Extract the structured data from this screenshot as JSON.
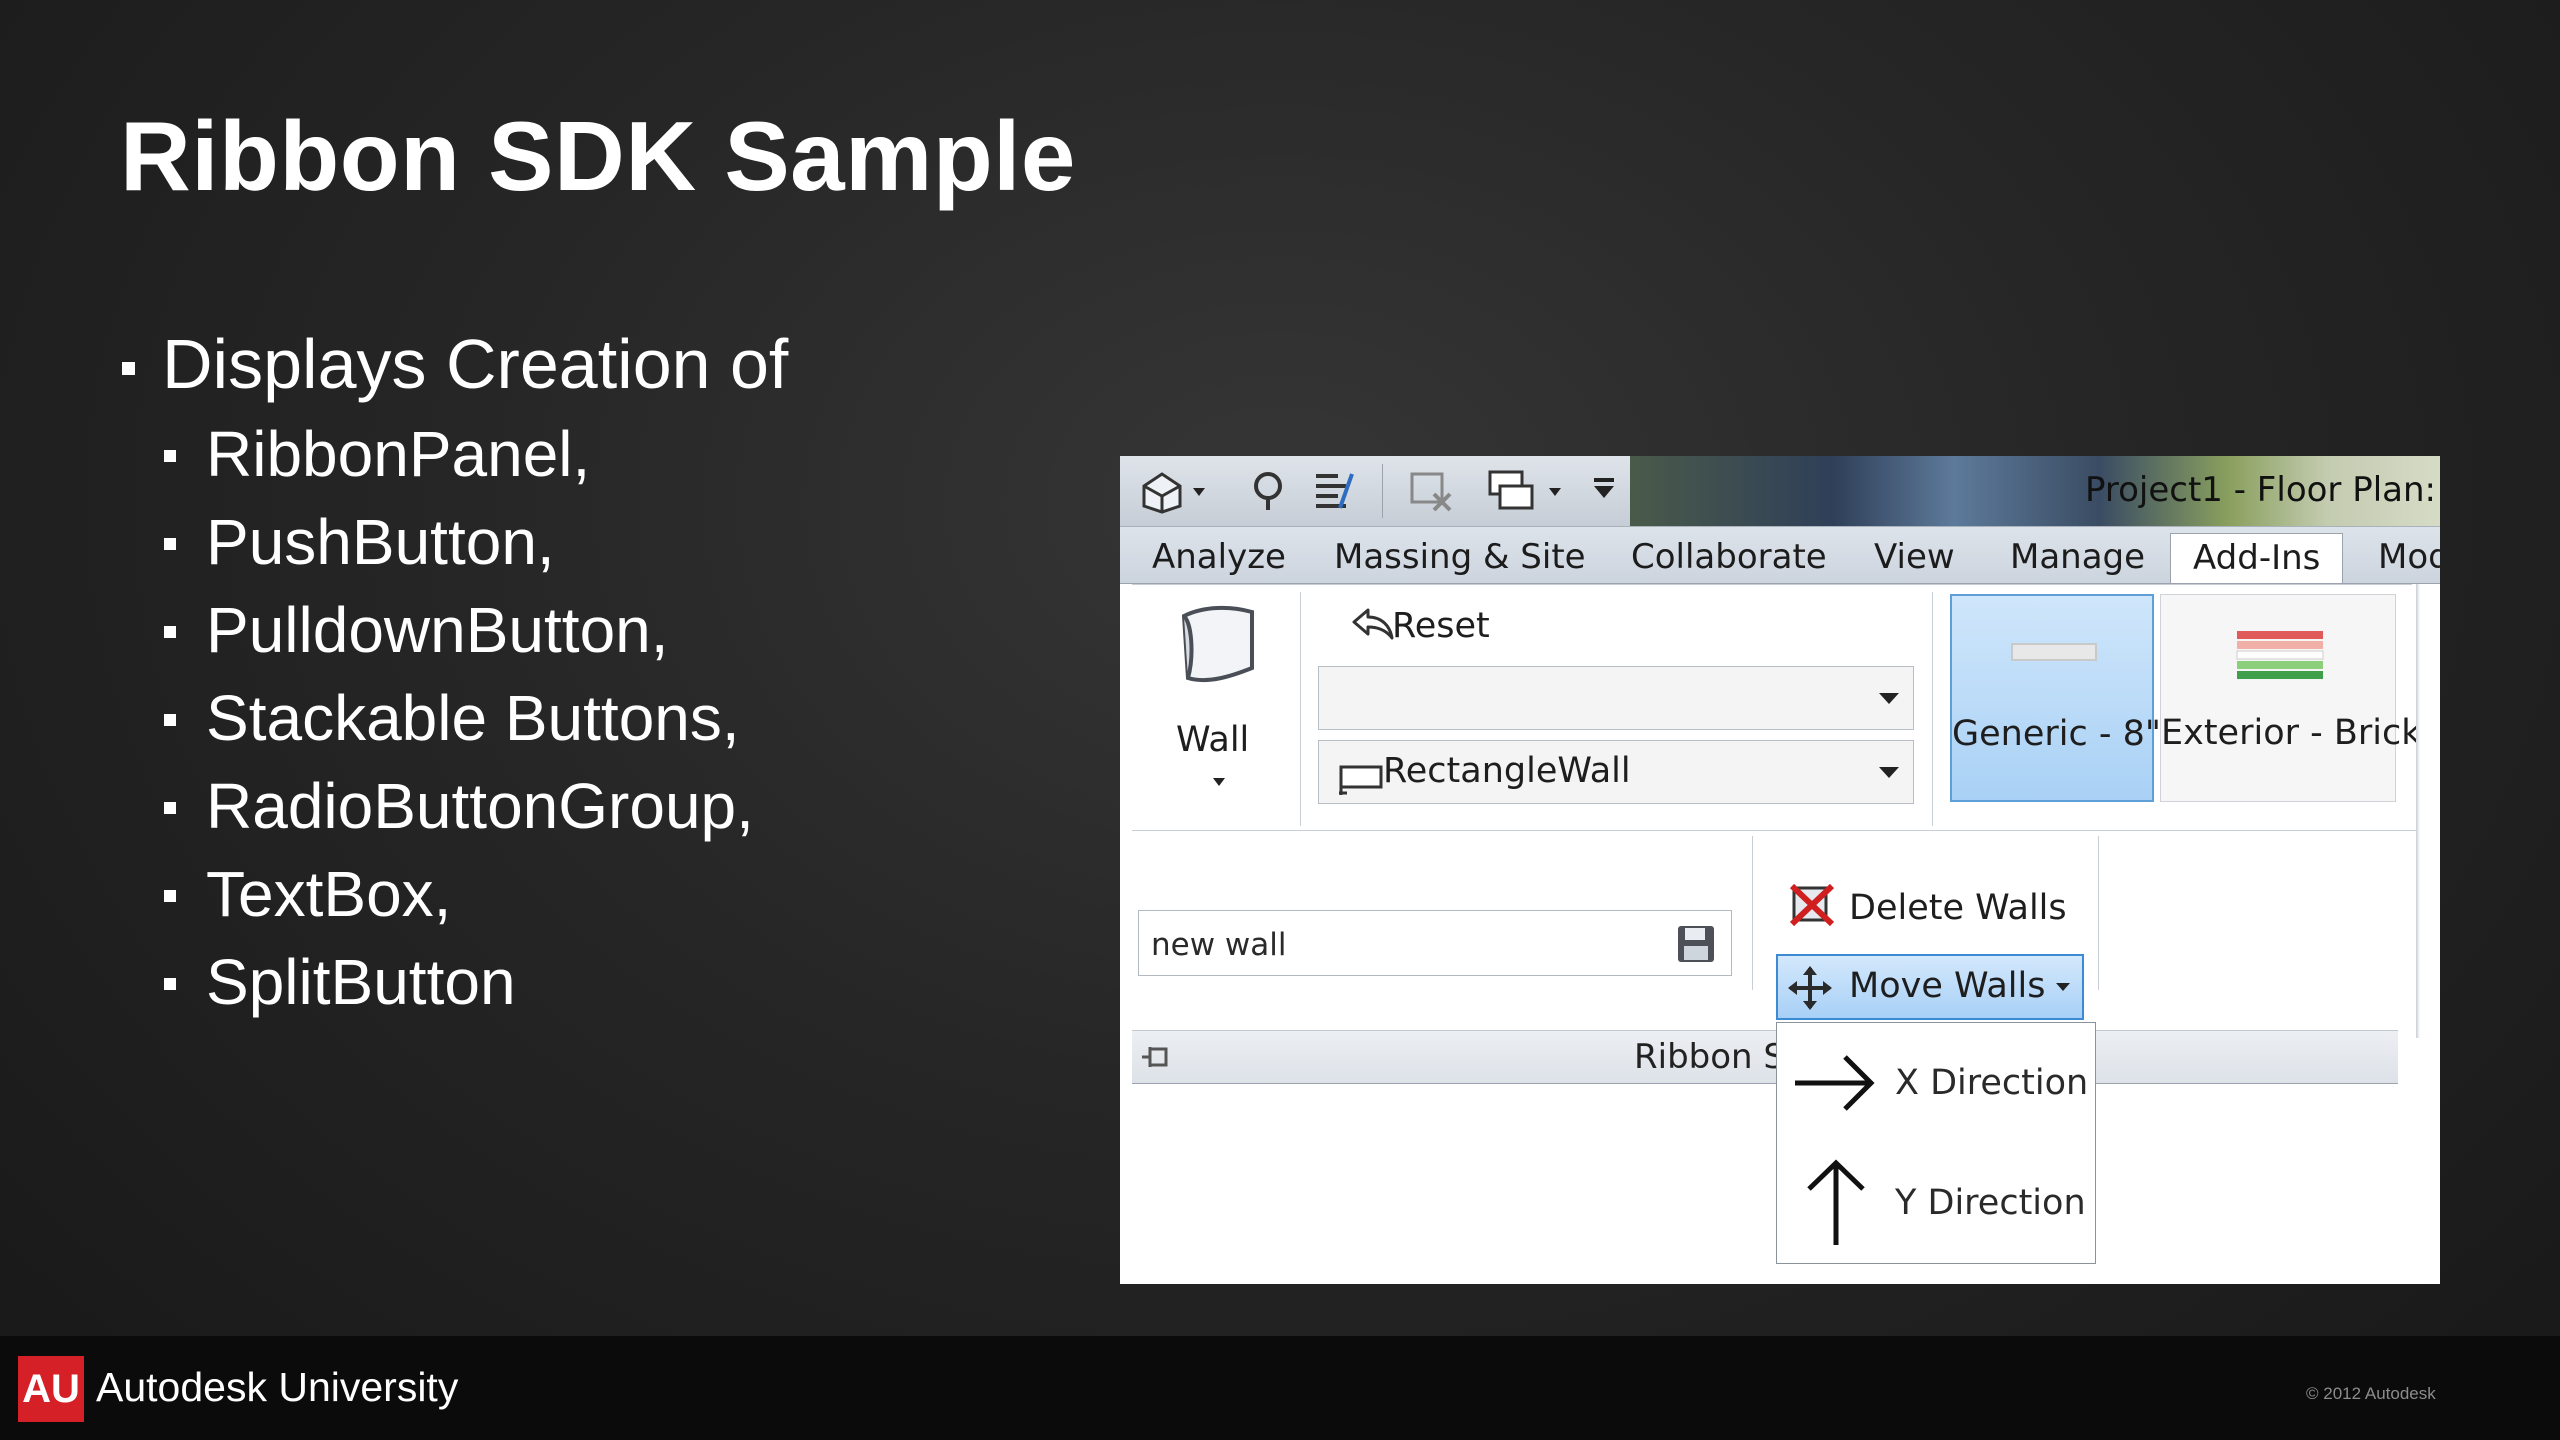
{
  "slide": {
    "title": "Ribbon SDK Sample",
    "bullet": "Displays Creation of",
    "sub_bullets": [
      "RibbonPanel,",
      "PushButton,",
      "PulldownButton,",
      "Stackable Buttons,",
      "RadioButtonGroup,",
      "TextBox,",
      "SplitButton"
    ]
  },
  "screenshot": {
    "window_title": "Project1 - Floor Plan:",
    "tabs": [
      "Analyze",
      "Massing & Site",
      "Collaborate",
      "View",
      "Manage",
      "Add-Ins",
      "Mod"
    ],
    "active_tab": "Add-Ins",
    "wall_button": "Wall",
    "reset_button": "Reset",
    "combo_empty_value": "",
    "combo_value": "RectangleWall",
    "radio_group": [
      "Generic - 8\"",
      "Exterior - Brick"
    ],
    "radio_selected": "Generic - 8\"",
    "textbox_value": "new wall",
    "delete_button": "Delete Walls",
    "move_button": "Move Walls",
    "move_menu": [
      "X Direction",
      "Y Direction"
    ],
    "panel_title": "Ribbon S"
  },
  "footer": {
    "logo": "AU",
    "brand": "Autodesk University",
    "copyright": "© 2012 Autodesk"
  },
  "colors": {
    "background": "#262626",
    "footer": "#0b0b0b",
    "logo_red": "#d52027",
    "selection_blue": "#a8d0f6"
  },
  "icons": {
    "qat": [
      "home-icon",
      "measure-icon",
      "tag-icon",
      "close-hidden-icon",
      "switch-windows-icon",
      "customize-icon"
    ],
    "wall": "wall-icon",
    "reset": "undo-arrow-icon",
    "combo": "rectangle-wall-icon",
    "textbox": "save-icon",
    "delete": "delete-icon",
    "move": "move-icon",
    "x_direction": "arrow-right-icon",
    "y_direction": "arrow-up-icon",
    "panel": "pin-icon"
  }
}
